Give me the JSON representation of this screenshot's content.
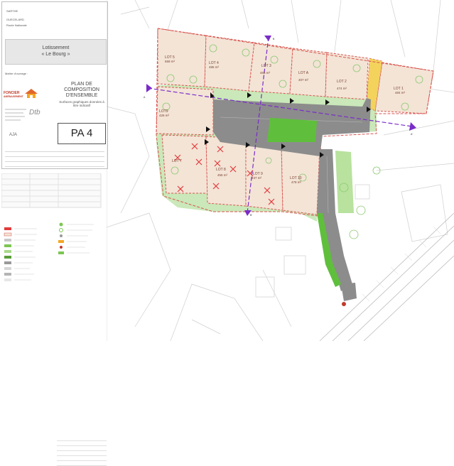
{
  "cartouche": {
    "department": "SARTHE",
    "commune": "GUECELARD",
    "route": "Route Nationale",
    "project_title": "Lotissement",
    "project_name": "« Le Bourg »",
    "moa_label": "Maître d'ouvrage :",
    "logo_foncier_1": "FONCIER",
    "logo_foncier_2": "AMÉNAGEMENT",
    "plan_title": "PLAN DE COMPOSITION D'ENSEMBLE",
    "plan_note": "Surfaces graphiques données à titre indicatif",
    "document_code": "PA 4",
    "logo_bet": "Dtb",
    "logo_arch": "AJA"
  },
  "lots": [
    {
      "id": "lot5",
      "label": "LOT 5",
      "area": "559 m²"
    },
    {
      "id": "lot4",
      "label": "LOT 4",
      "area": "485 m²"
    },
    {
      "id": "lot3",
      "label": "LOT 3",
      "area": "456 m²"
    },
    {
      "id": "lotA",
      "label": "LOT A",
      "area": "407 m²"
    },
    {
      "id": "lot2",
      "label": "LOT 2",
      "area": "474 m²"
    },
    {
      "id": "lot1",
      "label": "LOT 1",
      "area": "484 m²"
    },
    {
      "id": "lot9b",
      "label": "LOT9",
      "area": "426 m²"
    },
    {
      "id": "lot7",
      "label": "LOT 7",
      "area": ""
    },
    {
      "id": "lot8",
      "label": "LOT 8",
      "area": "455 m²"
    },
    {
      "id": "lot9",
      "label": "LOT 9",
      "area": "437 m²"
    },
    {
      "id": "lot10",
      "label": "LOT 10",
      "area": "478 m²"
    }
  ],
  "section_marks": {
    "a": "A",
    "a_prime": "A'",
    "b": "B",
    "b_prime": "B'"
  },
  "colors": {
    "lot_fill": "#f3e4d6",
    "lot_border": "#d9534f",
    "road": "#8c8c8c",
    "green_space": "#7cc653",
    "section_line": "#7a2cc9",
    "cross": "#e23b3b"
  },
  "icons": [
    "tree-icon",
    "cross-icon",
    "section-arrow-icon",
    "house-logo-icon"
  ]
}
